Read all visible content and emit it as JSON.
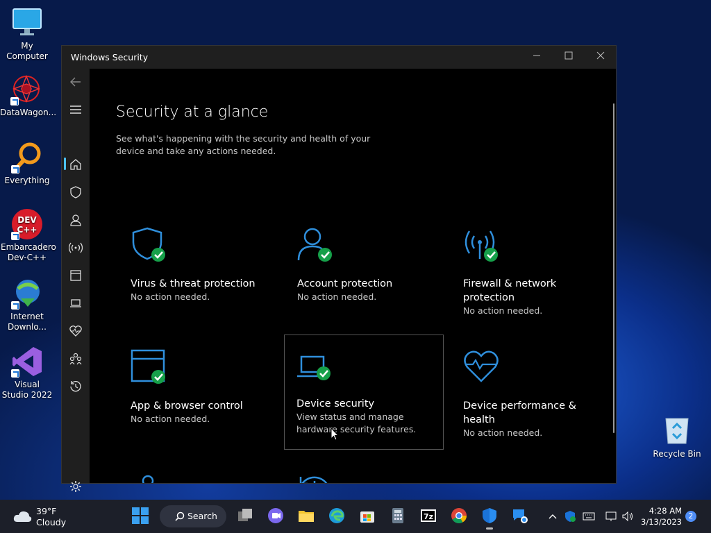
{
  "desktop": {
    "icons": [
      {
        "label": "My Computer",
        "icon": "monitor-icon"
      },
      {
        "label": "DataWagon...",
        "icon": "datawagon-icon"
      },
      {
        "label": "Everything",
        "icon": "magnifier-icon"
      },
      {
        "label": "Embarcadero Dev-C++",
        "icon": "devcpp-icon"
      },
      {
        "label": "Internet Downlo...",
        "icon": "idm-icon"
      },
      {
        "label": "Visual Studio 2022",
        "icon": "visual-studio-icon"
      }
    ],
    "recycle_bin": "Recycle Bin"
  },
  "window": {
    "title": "Windows Security",
    "heading": "Security at a glance",
    "subtitle": "See what's happening with the security and health of your device and take any actions needed.",
    "tiles": [
      {
        "title": "Virus & threat protection",
        "status": "No action needed.",
        "icon": "shield-icon",
        "ok": true
      },
      {
        "title": "Account protection",
        "status": "No action needed.",
        "icon": "person-icon",
        "ok": true
      },
      {
        "title": "Firewall & network protection",
        "status": "No action needed.",
        "icon": "antenna-icon",
        "ok": true
      },
      {
        "title": "App & browser control",
        "status": "No action needed.",
        "icon": "browser-window-icon",
        "ok": true
      },
      {
        "title": "Device security",
        "status": "View status and manage hardware security features.",
        "icon": "laptop-icon",
        "ok": true
      },
      {
        "title": "Device performance & health",
        "status": "No action needed.",
        "icon": "heart-icon",
        "ok": false
      }
    ]
  },
  "taskbar": {
    "weather_temp": "39°F",
    "weather_desc": "Cloudy",
    "search_label": "Search",
    "time": "4:28 AM",
    "date": "3/13/2023",
    "notifications": "2"
  },
  "colors": {
    "accent": "#4cc2ff",
    "ok_green": "#16a04a",
    "icon_blue": "#2f8fdc"
  }
}
